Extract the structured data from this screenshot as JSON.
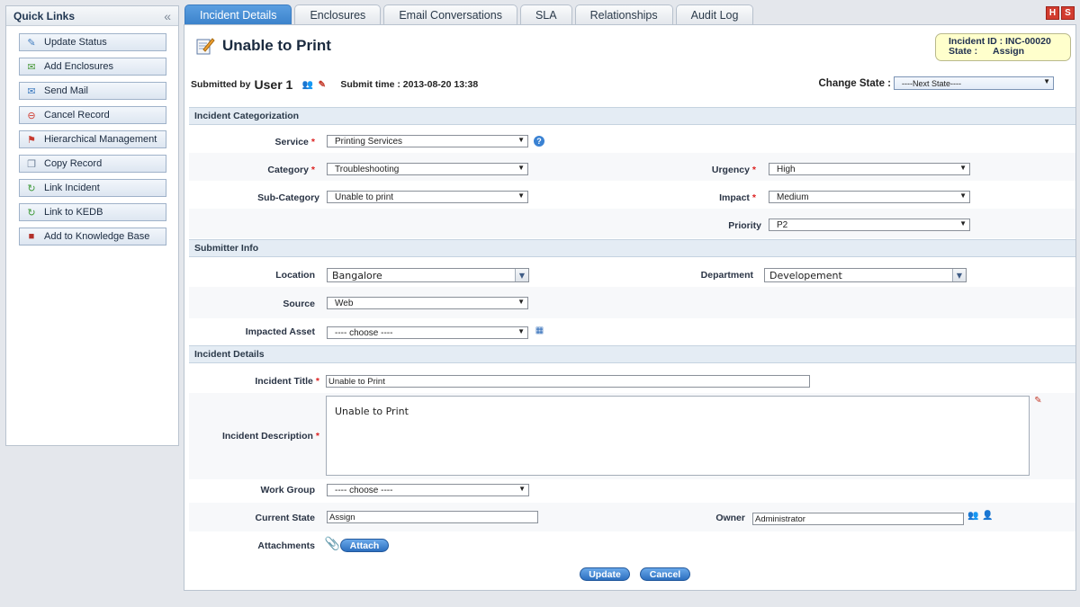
{
  "sidebar": {
    "title": "Quick Links",
    "items": [
      {
        "label": "Update Status",
        "icon": "✎",
        "color": "#3e7bbf"
      },
      {
        "label": "Add Enclosures",
        "icon": "✉",
        "color": "#4a9a3a"
      },
      {
        "label": "Send Mail",
        "icon": "✉",
        "color": "#3e7bbf"
      },
      {
        "label": "Cancel Record",
        "icon": "⊖",
        "color": "#d23c2f"
      },
      {
        "label": "Hierarchical Management",
        "icon": "⚑",
        "color": "#c73a2f"
      },
      {
        "label": "Copy Record",
        "icon": "❐",
        "color": "#6a7d95"
      },
      {
        "label": "Link Incident",
        "icon": "↻",
        "color": "#3f9a3a"
      },
      {
        "label": "Link to KEDB",
        "icon": "↻",
        "color": "#3f9a3a"
      },
      {
        "label": "Add to Knowledge Base",
        "icon": "■",
        "color": "#b2302a"
      }
    ]
  },
  "tabs": [
    "Incident Details",
    "Enclosures",
    "Email Conversations",
    "SLA",
    "Relationships",
    "Audit Log"
  ],
  "top_icons": [
    "H",
    "S"
  ],
  "header": {
    "title": "Unable to Print",
    "incident_id_label": "Incident ID : INC-00020",
    "state_label": "State :",
    "state_value": "Assign",
    "submitted_by_label": "Submitted by",
    "submitted_user": "User 1",
    "submit_time": "Submit time : 2013-08-20 13:38",
    "change_state_label": "Change State :",
    "change_state_value": "----Next State----"
  },
  "sections": {
    "categorization": "Incident Categorization",
    "submitter": "Submitter Info",
    "details": "Incident Details"
  },
  "fields": {
    "service": {
      "label": "Service",
      "value": "Printing Services"
    },
    "category": {
      "label": "Category",
      "value": "Troubleshooting"
    },
    "subcategory": {
      "label": "Sub-Category",
      "value": "Unable to print"
    },
    "urgency": {
      "label": "Urgency",
      "value": "High"
    },
    "impact": {
      "label": "Impact",
      "value": "Medium"
    },
    "priority": {
      "label": "Priority",
      "value": "P2"
    },
    "location": {
      "label": "Location",
      "value": "Bangalore"
    },
    "department": {
      "label": "Department",
      "value": "Developement"
    },
    "source": {
      "label": "Source",
      "value": "Web"
    },
    "impacted_asset": {
      "label": "Impacted Asset",
      "value": "---- choose ----"
    },
    "incident_title": {
      "label": "Incident Title",
      "value": "Unable to Print"
    },
    "incident_description": {
      "label": "Incident Description",
      "value": "Unable to Print"
    },
    "work_group": {
      "label": "Work Group",
      "value": "---- choose ----"
    },
    "current_state": {
      "label": "Current State",
      "value": "Assign"
    },
    "owner": {
      "label": "Owner",
      "value": "Administrator"
    },
    "attachments": {
      "label": "Attachments",
      "button": "Attach"
    }
  },
  "actions": {
    "update": "Update",
    "cancel": "Cancel"
  }
}
